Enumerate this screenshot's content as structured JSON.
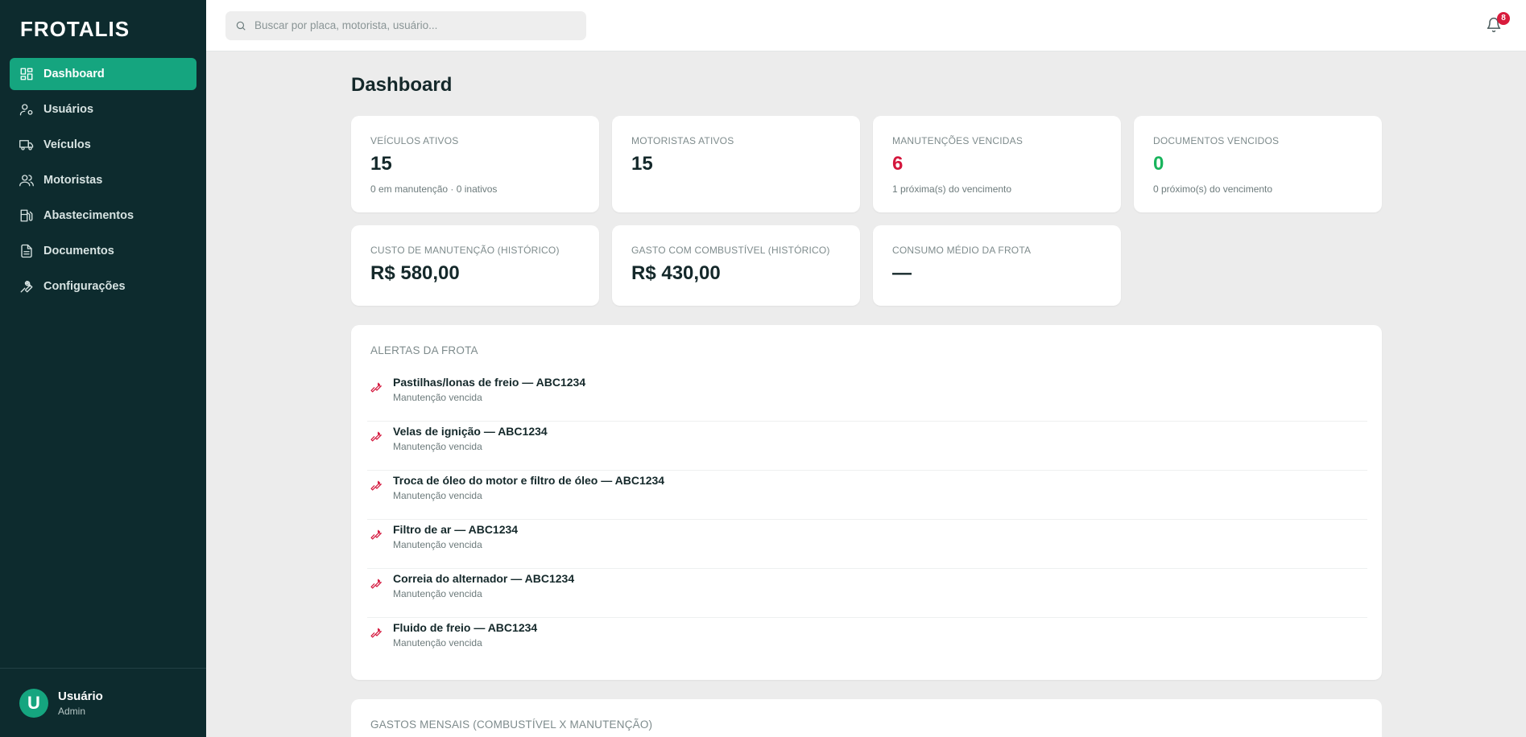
{
  "sidebar": {
    "logo": "FROTALIS",
    "items": [
      {
        "label": "Dashboard",
        "icon": "dashboard-icon",
        "active": true
      },
      {
        "label": "Usuários",
        "icon": "user-gear-icon"
      },
      {
        "label": "Veículos",
        "icon": "truck-icon"
      },
      {
        "label": "Motoristas",
        "icon": "users-icon"
      },
      {
        "label": "Abastecimentos",
        "icon": "fuel-icon"
      },
      {
        "label": "Documentos",
        "icon": "document-icon"
      },
      {
        "label": "Configurações",
        "icon": "wrench-icon"
      }
    ],
    "user": {
      "initial": "U",
      "name": "Usuário",
      "role": "Admin"
    }
  },
  "topbar": {
    "search_placeholder": "Buscar por placa, motorista, usuário...",
    "notifications_count": "8"
  },
  "page": {
    "title": "Dashboard"
  },
  "cards": [
    {
      "label": "VEÍCULOS ATIVOS",
      "value": "15",
      "sub": "0 em manutenção · 0 inativos"
    },
    {
      "label": "MOTORISTAS ATIVOS",
      "value": "15",
      "sub": ""
    },
    {
      "label": "MANUTENÇÕES VENCIDAS",
      "value": "6",
      "sub": "1 próxima(s) do vencimento",
      "color": "#d4163c"
    },
    {
      "label": "DOCUMENTOS VENCIDOS",
      "value": "0",
      "sub": "0 próximo(s) do vencimento",
      "color": "#18b45c"
    },
    {
      "label": "CUSTO DE MANUTENÇÃO (HISTÓRICO)",
      "value": "R$ 580,00"
    },
    {
      "label": "GASTO COM COMBUSTÍVEL (HISTÓRICO)",
      "value": "R$ 430,00"
    },
    {
      "label": "CONSUMO MÉDIO DA FROTA",
      "value": "—"
    }
  ],
  "alerts": {
    "title": "ALERTAS DA FROTA",
    "items": [
      {
        "title": "Pastilhas/lonas de freio — ABC1234",
        "sub": "Manutenção vencida"
      },
      {
        "title": "Velas de ignição — ABC1234",
        "sub": "Manutenção vencida"
      },
      {
        "title": "Troca de óleo do motor e filtro de óleo — ABC1234",
        "sub": "Manutenção vencida"
      },
      {
        "title": "Filtro de ar — ABC1234",
        "sub": "Manutenção vencida"
      },
      {
        "title": "Correia do alternador — ABC1234",
        "sub": "Manutenção vencida"
      },
      {
        "title": "Fluido de freio — ABC1234",
        "sub": "Manutenção vencida"
      }
    ]
  },
  "expenses": {
    "title": "GASTOS MENSAIS (COMBUSTÍVEL X MANUTENÇÃO)"
  },
  "colors": {
    "sidebar_bg": "#0d2b2e",
    "accent": "#15a57f",
    "danger": "#d4163c",
    "success": "#18b45c"
  }
}
